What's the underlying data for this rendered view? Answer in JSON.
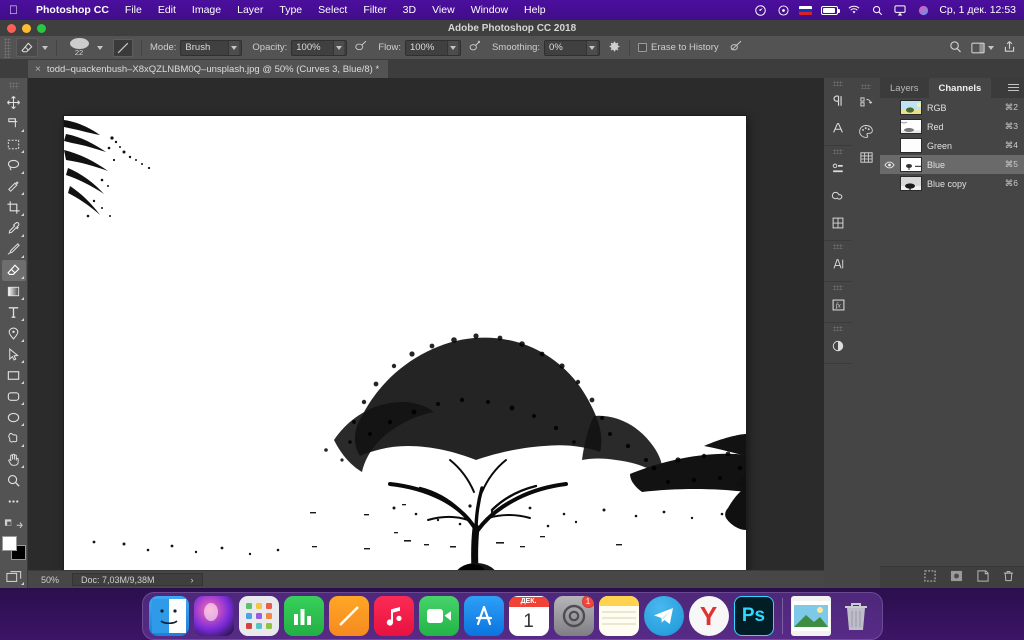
{
  "menubar": {
    "apple_icon": "apple-logo-icon",
    "app_name": "Photoshop CC",
    "items": [
      "File",
      "Edit",
      "Image",
      "Layer",
      "Type",
      "Select",
      "Filter",
      "3D",
      "View",
      "Window",
      "Help"
    ],
    "status_icons": [
      "location-arrow-icon",
      "timemachine-icon",
      "keyboard-flag-ru-icon",
      "battery-charging-icon",
      "wifi-icon",
      "search-icon",
      "airplay-icon",
      "siri-icon"
    ],
    "clock": "Ср, 1 дек.  12:53",
    "bar_color": "#4b0f9e"
  },
  "window": {
    "title": "Adobe Photoshop CC 2018",
    "traffic_lights": [
      "#ff5f57",
      "#febc2e",
      "#28c840"
    ]
  },
  "options_bar": {
    "tool_icon": "eraser-tool-icon",
    "brush_size": "22",
    "mode_label": "Mode:",
    "mode_value": "Brush",
    "opacity_label": "Opacity:",
    "opacity_value": "100%",
    "airbrush_icon": "airbrush-pressure-icon",
    "flow_label": "Flow:",
    "flow_value": "100%",
    "smoothing_airbrush_icon": "smoothing-airbrush-icon",
    "smoothing_label": "Smoothing:",
    "smoothing_value": "0%",
    "gear_icon": "gear-icon",
    "erase_to_history_label": "Erase to History",
    "tablet_pressure_icon": "tablet-pressure-size-icon",
    "right_icons": [
      "search-icon",
      "workspace-switcher-icon",
      "share-icon"
    ]
  },
  "document_tab": {
    "close_icon": "close-icon",
    "title": "todd–quackenbush–X8xQZLNBM0Q–unsplash.jpg @ 50% (Curves 3, Blue/8) *"
  },
  "toolbar": {
    "tools": [
      {
        "name": "move-tool",
        "label": "Move Tool",
        "active": false
      },
      {
        "name": "artboard-tool",
        "label": "Artboard Tool",
        "active": false
      },
      {
        "name": "rectangular-marquee-tool",
        "label": "Rectangular Marquee Tool",
        "active": false
      },
      {
        "name": "lasso-tool",
        "label": "Lasso Tool",
        "active": false
      },
      {
        "name": "quick-selection-tool",
        "label": "Quick Selection Tool",
        "active": false
      },
      {
        "name": "crop-tool",
        "label": "Crop Tool",
        "active": false
      },
      {
        "name": "eyedropper-tool",
        "label": "Eyedropper Tool",
        "active": false
      },
      {
        "name": "brush-tool",
        "label": "Brush Tool",
        "active": false
      },
      {
        "name": "eraser-tool",
        "label": "Eraser Tool",
        "active": true
      },
      {
        "name": "gradient-tool",
        "label": "Gradient Tool",
        "active": false
      },
      {
        "name": "type-tool",
        "label": "Horizontal Type Tool",
        "active": false
      },
      {
        "name": "pen-tool",
        "label": "Pen Tool",
        "active": false
      },
      {
        "name": "path-selection-tool",
        "label": "Path Selection Tool",
        "active": false
      },
      {
        "name": "rectangle-tool",
        "label": "Rectangle Tool",
        "active": false
      },
      {
        "name": "rounded-rectangle-tool",
        "label": "Rounded Rectangle Tool",
        "active": false
      },
      {
        "name": "ellipse-tool",
        "label": "Ellipse Tool",
        "active": false
      },
      {
        "name": "custom-shape-tool",
        "label": "Custom Shape Tool",
        "active": false
      },
      {
        "name": "hand-tool",
        "label": "Hand Tool",
        "active": false
      },
      {
        "name": "zoom-tool",
        "label": "Zoom Tool",
        "active": false
      },
      {
        "name": "edit-toolbar-tool",
        "label": "Edit Toolbar",
        "active": false
      }
    ],
    "foreground_color": "#ffffff",
    "background_color": "#000000",
    "screen_mode_icon": "screen-mode-icon"
  },
  "canvas": {
    "image_description": "High contrast black and white photo of an acacia tree on open ground with branches at upper left and a second tree cluster at right",
    "zoom": "50%"
  },
  "status_bar": {
    "zoom": "50%",
    "doc_info": "Doc: 7,03M/9,38M",
    "expand_icon": "chevron-right-icon"
  },
  "rail_left": {
    "icons": [
      "history-icon",
      "color-swatches-icon",
      "swatches-grid-icon"
    ]
  },
  "rail_right": {
    "icons": [
      "paragraph-icon",
      "character-icon",
      "properties-icon",
      "creative-cloud-libraries-icon",
      "adjustments-icon",
      "character-styles-icon",
      "layer-effects-fx-icon",
      "adjustment-layer-icon"
    ]
  },
  "panel": {
    "tabs": [
      {
        "label": "Layers",
        "active": false
      },
      {
        "label": "Channels",
        "active": true
      }
    ],
    "menu_icon": "panel-menu-icon",
    "channels": [
      {
        "name": "RGB",
        "shortcut": "⌘2",
        "visible": false,
        "selected": false,
        "thumb": "rgb-composite"
      },
      {
        "name": "Red",
        "shortcut": "⌘3",
        "visible": false,
        "selected": false,
        "thumb": "red-channel"
      },
      {
        "name": "Green",
        "shortcut": "⌘4",
        "visible": false,
        "selected": false,
        "thumb": "green-channel"
      },
      {
        "name": "Blue",
        "shortcut": "⌘5",
        "visible": true,
        "selected": true,
        "thumb": "blue-channel"
      },
      {
        "name": "Blue copy",
        "shortcut": "⌘6",
        "visible": false,
        "selected": false,
        "thumb": "blue-copy-channel"
      }
    ],
    "footer_icons": [
      "load-channel-as-selection-icon",
      "save-selection-as-channel-icon",
      "new-channel-icon",
      "delete-channel-icon"
    ]
  },
  "dock": {
    "apps": [
      {
        "name": "finder",
        "label": "Finder",
        "running": true
      },
      {
        "name": "siri",
        "label": "Siri",
        "running": false
      },
      {
        "name": "launchpad",
        "label": "Launchpad",
        "running": false
      },
      {
        "name": "numbers",
        "label": "Numbers",
        "running": false
      },
      {
        "name": "notes-yellow",
        "label": "Notes",
        "running": false
      },
      {
        "name": "music",
        "label": "Music",
        "running": false
      },
      {
        "name": "facetime",
        "label": "FaceTime",
        "running": false
      },
      {
        "name": "app-store",
        "label": "App Store",
        "running": false
      },
      {
        "name": "calendar",
        "label": "Calendar",
        "running": false,
        "month": "ДЕК.",
        "day": "1"
      },
      {
        "name": "system-preferences",
        "label": "System Preferences",
        "running": false,
        "badge": "1"
      },
      {
        "name": "stickies",
        "label": "Stickies",
        "running": false
      },
      {
        "name": "telegram",
        "label": "Telegram",
        "running": true
      },
      {
        "name": "yandex-browser",
        "label": "Yandex Browser",
        "running": true
      },
      {
        "name": "photoshop",
        "label": "Ps",
        "running": true
      }
    ],
    "stack_items": [
      {
        "name": "photo-file",
        "label": "Photo"
      },
      {
        "name": "trash",
        "label": "Trash"
      }
    ]
  }
}
